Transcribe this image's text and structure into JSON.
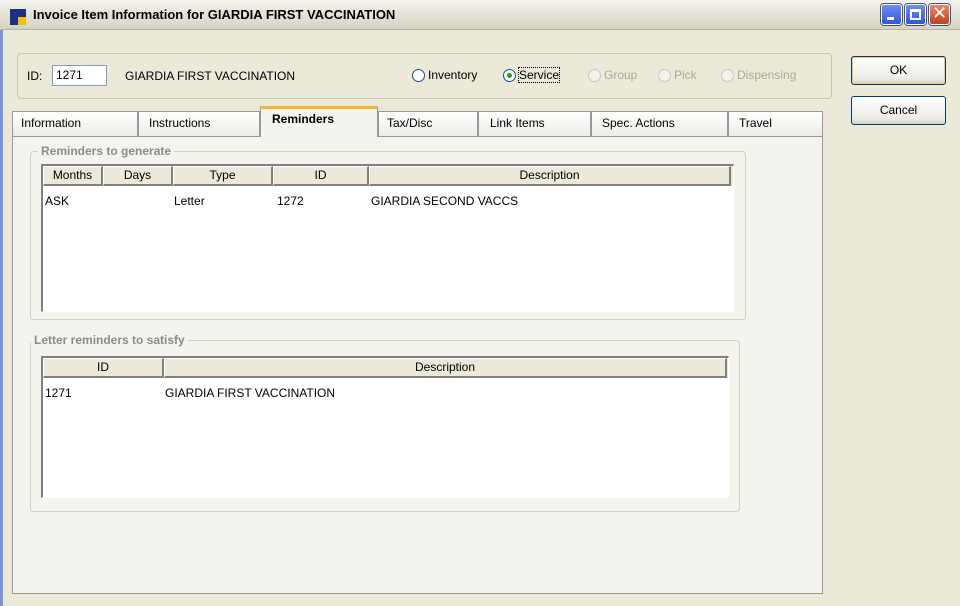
{
  "window": {
    "title": "Invoice Item Information for GIARDIA FIRST VACCINATION",
    "controls": {
      "minimize": "minimize",
      "maximize": "maximize",
      "close": "✕"
    }
  },
  "header": {
    "id_label": "ID:",
    "id_value": "1271",
    "item_name": "GIARDIA FIRST VACCINATION",
    "item_types": [
      {
        "label": "Inventory",
        "checked": false,
        "enabled": true
      },
      {
        "label": "Service",
        "checked": true,
        "enabled": true
      },
      {
        "label": "Group",
        "checked": false,
        "enabled": false
      },
      {
        "label": "Pick",
        "checked": false,
        "enabled": false
      },
      {
        "label": "Dispensing",
        "checked": false,
        "enabled": false
      }
    ]
  },
  "buttons": {
    "ok": "OK",
    "cancel": "Cancel"
  },
  "tabs": [
    {
      "label": "Information",
      "active": false
    },
    {
      "label": "Instructions",
      "active": false
    },
    {
      "label": "Reminders",
      "active": true
    },
    {
      "label": "Tax/Disc",
      "active": false
    },
    {
      "label": "Link Items",
      "active": false
    },
    {
      "label": "Spec. Actions",
      "active": false
    },
    {
      "label": "Travel",
      "active": false
    }
  ],
  "reminders_to_generate": {
    "title": "Reminders to generate",
    "columns": [
      "Months",
      "Days",
      "Type",
      "ID",
      "Description"
    ],
    "rows": [
      {
        "months": "ASK",
        "days": "",
        "type": "Letter",
        "id": "1272",
        "description": "GIARDIA SECOND VACCS"
      }
    ]
  },
  "letter_reminders_to_satisfy": {
    "title": "Letter reminders to satisfy",
    "columns": [
      "ID",
      "Description"
    ],
    "rows": [
      {
        "id": "1271",
        "description": "GIARDIA FIRST VACCINATION"
      }
    ]
  },
  "colors": {
    "window_bg": "#ece9d8",
    "tab_page_bg": "#f4f3ee",
    "active_tab_accent": "#f4b540",
    "radio_dot": "#21a121"
  }
}
